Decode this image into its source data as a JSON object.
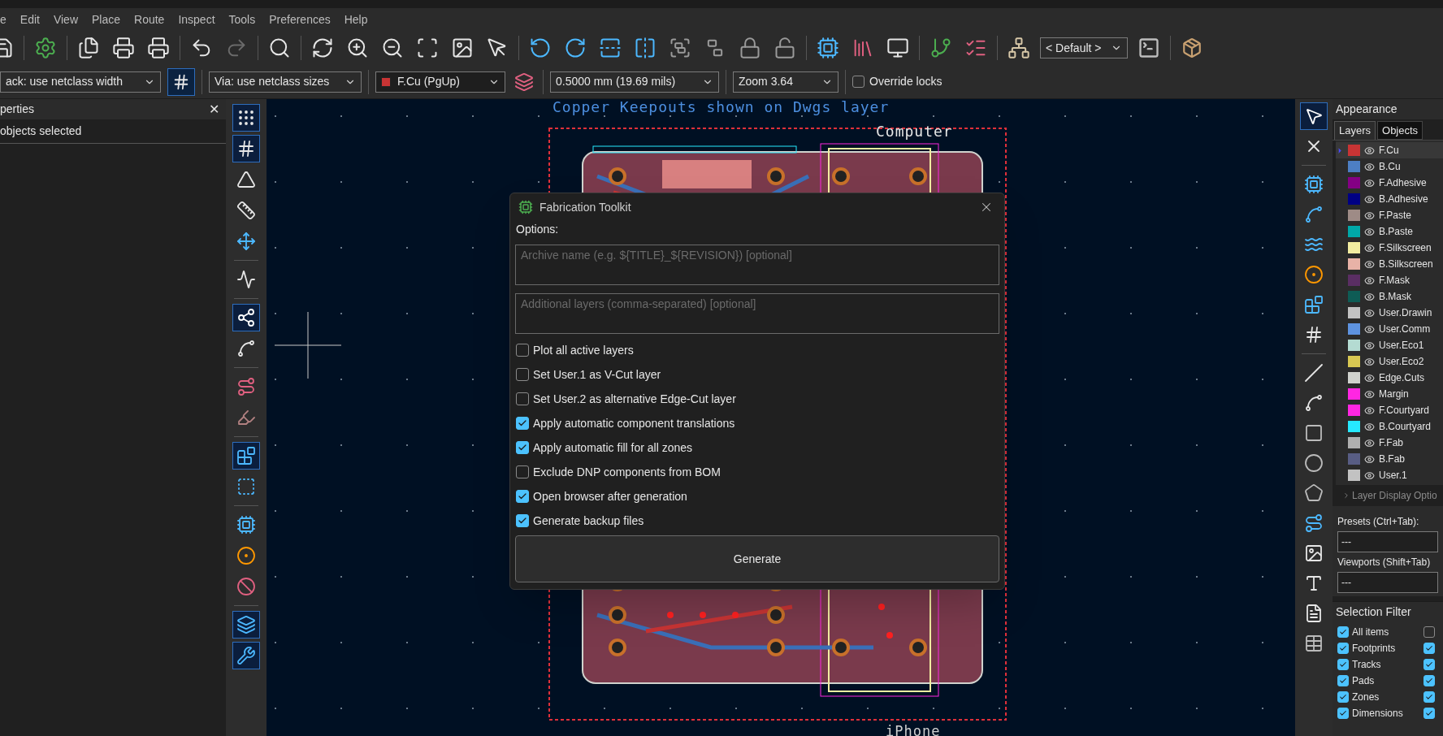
{
  "menu": [
    "e",
    "Edit",
    "View",
    "Place",
    "Route",
    "Inspect",
    "Tools",
    "Preferences",
    "Help"
  ],
  "toolbar": {
    "buttons": [
      {
        "disabled": false
      },
      {
        "disabled": false
      },
      {
        "disabled": false
      },
      {
        "disabled": false
      },
      {
        "disabled": false
      },
      {
        "disabled": false
      },
      {
        "disabled": true
      },
      {
        "disabled": false
      },
      {
        "disabled": false
      },
      {
        "disabled": false
      },
      {
        "disabled": false
      },
      {
        "disabled": false
      },
      {
        "disabled": false
      },
      {
        "disabled": false
      },
      {
        "disabled": false
      },
      {
        "disabled": false
      },
      {
        "disabled": false
      },
      {
        "disabled": false
      },
      {
        "disabled": false
      },
      {
        "disabled": false
      },
      {
        "disabled": false
      },
      {
        "disabled": false
      },
      {
        "disabled": false
      },
      {
        "disabled": false
      },
      {
        "disabled": false
      },
      {
        "disabled": false
      },
      {
        "disabled": false
      },
      {
        "disabled": false
      }
    ],
    "preset": "< Default >"
  },
  "options_bar": {
    "track_width": "ack: use netclass width",
    "via_size": "Via: use netclass sizes",
    "layer": {
      "label": "F.Cu (PgUp)",
      "color": "#c83434"
    },
    "grid": "0.5000 mm (19.69 mils)",
    "zoom": "Zoom 3.64",
    "override_locks": {
      "label": "Override locks",
      "checked": false
    }
  },
  "properties": {
    "title": "perties",
    "close": "✕",
    "status": "objects selected"
  },
  "left_toolbar": [
    {
      "active": true
    },
    {
      "active": true
    },
    {
      "active": false
    },
    {
      "active": false
    },
    {
      "active": false
    },
    {
      "active": false
    },
    {
      "active": true
    },
    {
      "active": false
    },
    {
      "active": false
    },
    {
      "active": false
    },
    {
      "active": true
    },
    {
      "active": false
    },
    {
      "active": false
    },
    {
      "active": false
    },
    {
      "active": false
    },
    {
      "active": true
    },
    {
      "active": true
    }
  ],
  "canvas": {
    "labels": [
      {
        "kind": "note",
        "text": "Copper Keepouts shown on Dwgs layer"
      },
      {
        "kind": "top",
        "text": "Computer"
      },
      {
        "kind": "bottom",
        "text": "iPhone"
      }
    ]
  },
  "dialog": {
    "title": "Fabrication Toolkit",
    "section": "Options:",
    "fields": [
      {
        "placeholder": "Archive name (e.g. ${TITLE}_${REVISION}) [optional]"
      },
      {
        "placeholder": "Additional layers (comma-separated) [optional]"
      }
    ],
    "options": [
      {
        "label": "Plot all active layers",
        "checked": false
      },
      {
        "label": "Set User.1 as V-Cut layer",
        "checked": false
      },
      {
        "label": "Set User.2 as alternative Edge-Cut layer",
        "checked": false
      },
      {
        "label": "Apply automatic component translations",
        "checked": true
      },
      {
        "label": "Apply automatic fill for all zones",
        "checked": true
      },
      {
        "label": "Exclude DNP components from BOM",
        "checked": false
      },
      {
        "label": "Open browser after generation",
        "checked": true
      },
      {
        "label": "Generate backup files",
        "checked": true
      }
    ],
    "button": "Generate"
  },
  "right_toolbar": [
    {
      "active": true
    },
    {
      "active": false
    },
    {
      "active": false
    },
    {
      "active": false
    },
    {
      "active": false
    },
    {
      "active": false
    },
    {
      "active": false
    },
    {
      "active": false
    },
    {
      "active": false
    },
    {
      "active": false
    },
    {
      "active": false
    },
    {
      "active": false
    },
    {
      "active": false
    },
    {
      "active": false
    },
    {
      "active": false
    },
    {
      "active": false
    },
    {
      "active": false
    },
    {
      "active": false
    }
  ],
  "appearance": {
    "title": "Appearance",
    "tabs": [
      {
        "label": "Layers",
        "selected": true
      },
      {
        "label": "Objects",
        "selected": false
      }
    ],
    "layers": [
      {
        "name": "F.Cu",
        "color": "#c83434",
        "selected": true
      },
      {
        "name": "B.Cu",
        "color": "#4d7fc4",
        "selected": false
      },
      {
        "name": "F.Adhesive",
        "color": "#840084",
        "selected": false
      },
      {
        "name": "B.Adhesive",
        "color": "#000084",
        "selected": false
      },
      {
        "name": "F.Paste",
        "color": "#9e8b86",
        "selected": false
      },
      {
        "name": "B.Paste",
        "color": "#00a8a8",
        "selected": false
      },
      {
        "name": "F.Silkscreen",
        "color": "#f2eda1",
        "selected": false
      },
      {
        "name": "B.Silkscreen",
        "color": "#e8b2a7",
        "selected": false
      },
      {
        "name": "F.Mask",
        "color": "#5a2e63",
        "selected": false
      },
      {
        "name": "B.Mask",
        "color": "#0e5c55",
        "selected": false
      },
      {
        "name": "User.Drawin",
        "color": "#c2c2c2",
        "selected": false
      },
      {
        "name": "User.Comm",
        "color": "#5e93e0",
        "selected": false
      },
      {
        "name": "User.Eco1",
        "color": "#b4dbd2",
        "selected": false
      },
      {
        "name": "User.Eco2",
        "color": "#d8c852",
        "selected": false
      },
      {
        "name": "Edge.Cuts",
        "color": "#d0d2cd",
        "selected": false
      },
      {
        "name": "Margin",
        "color": "#ff26e2",
        "selected": false
      },
      {
        "name": "F.Courtyard",
        "color": "#ff26e2",
        "selected": false
      },
      {
        "name": "B.Courtyard",
        "color": "#26e9ff",
        "selected": false
      },
      {
        "name": "F.Fab",
        "color": "#afafaf",
        "selected": false
      },
      {
        "name": "B.Fab",
        "color": "#585d84",
        "selected": false
      },
      {
        "name": "User.1",
        "color": "#c2c2c2",
        "selected": false
      }
    ],
    "display_options": "Layer Display Optio",
    "presets_label": "Presets (Ctrl+Tab):",
    "presets_value": "---",
    "viewports_label": "Viewports (Shift+Tab)",
    "viewports_value": "---",
    "filter_title": "Selection Filter",
    "filters": [
      {
        "label": "All items",
        "checked": true
      },
      {
        "label": "Footprints",
        "checked": true
      },
      {
        "label": "Tracks",
        "checked": true
      },
      {
        "label": "Pads",
        "checked": true
      },
      {
        "label": "Zones",
        "checked": true
      },
      {
        "label": "Dimensions",
        "checked": true
      }
    ],
    "filters_col2": [
      {
        "checked": false
      },
      {
        "checked": true
      },
      {
        "checked": true
      },
      {
        "checked": true
      },
      {
        "checked": true
      },
      {
        "checked": true
      }
    ]
  }
}
